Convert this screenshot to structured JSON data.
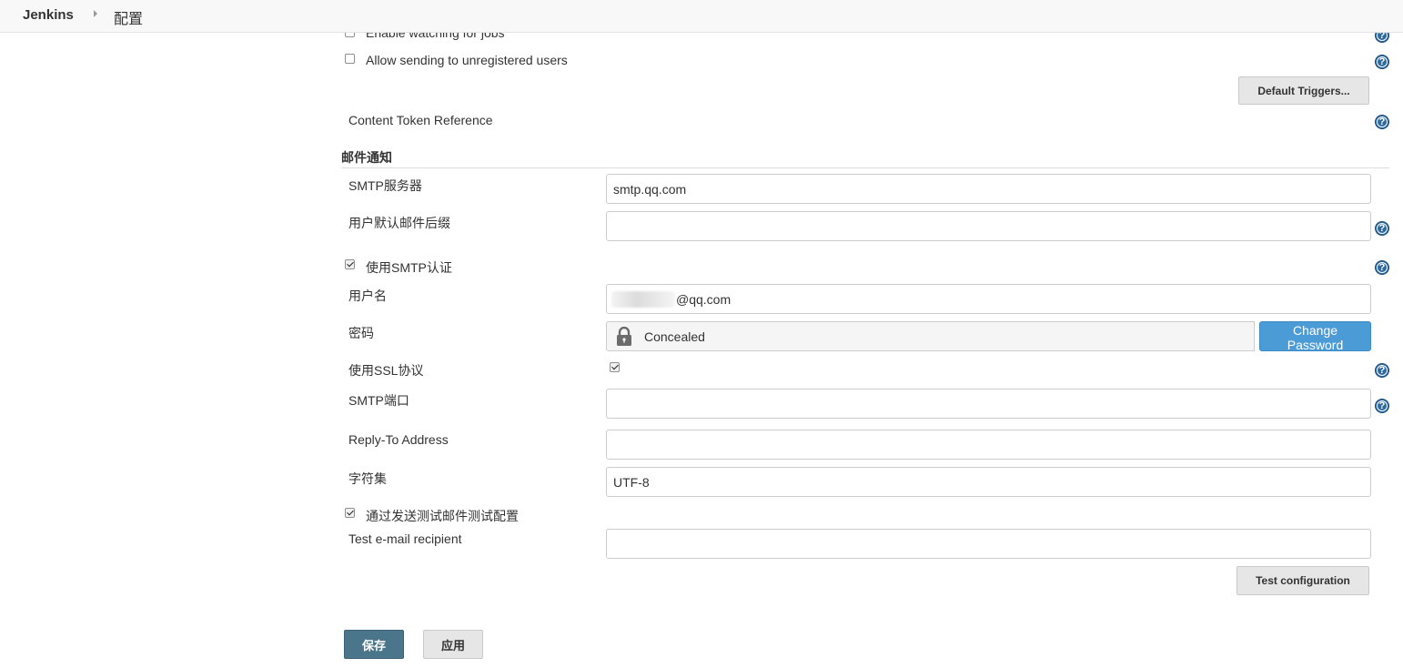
{
  "header": {
    "app_name": "Jenkins",
    "page": "配置"
  },
  "extended_email": {
    "enable_watching_label": "Enable watching for jobs",
    "enable_watching_checked": false,
    "allow_unregistered_label": "Allow sending to unregistered users",
    "allow_unregistered_checked": false,
    "default_triggers_button": "Default Triggers...",
    "content_token_reference": "Content Token Reference"
  },
  "mail_notification": {
    "section_title": "邮件通知",
    "smtp_server_label": "SMTP服务器",
    "smtp_server_value": "smtp.qq.com",
    "default_suffix_label": "用户默认邮件后缀",
    "default_suffix_value": "",
    "use_smtp_auth_label": "使用SMTP认证",
    "use_smtp_auth_checked": true,
    "username_label": "用户名",
    "username_value": "@qq.com",
    "password_label": "密码",
    "password_state": "Concealed",
    "change_password_button": "Change Password",
    "use_ssl_label": "使用SSL协议",
    "use_ssl_checked": true,
    "smtp_port_label": "SMTP端口",
    "smtp_port_value": "",
    "reply_to_label": "Reply-To Address",
    "reply_to_value": "",
    "charset_label": "字符集",
    "charset_value": "UTF-8",
    "test_config_label": "通过发送测试邮件测试配置",
    "test_config_checked": true,
    "test_recipient_label": "Test e-mail recipient",
    "test_recipient_value": "",
    "test_config_button": "Test configuration"
  },
  "footer": {
    "save_button": "保存",
    "apply_button": "应用"
  },
  "help_icon_glyph": "?",
  "colors": {
    "save_button": "#4b758b",
    "change_password_button": "#4a9bd6",
    "help_icon": "#2d6a9f"
  }
}
